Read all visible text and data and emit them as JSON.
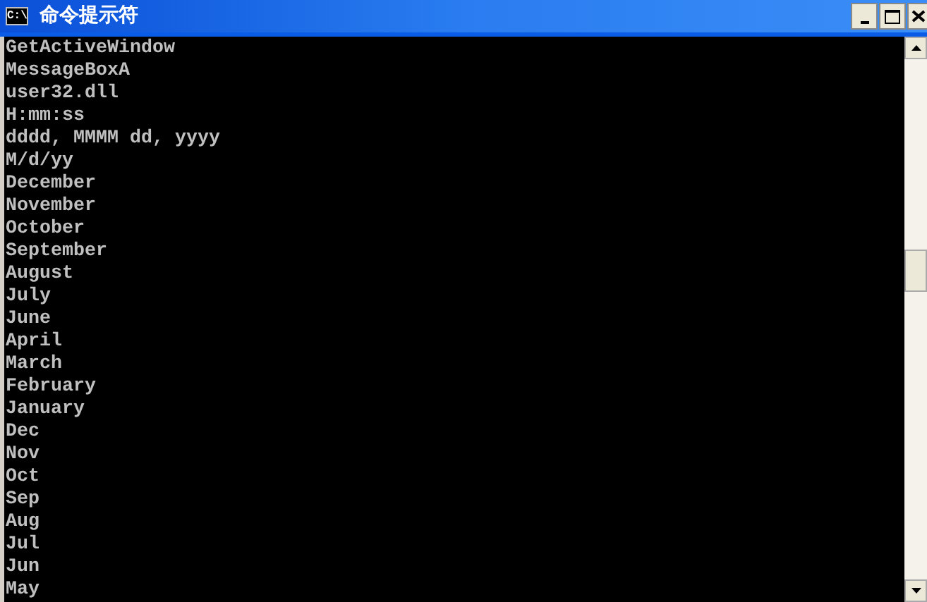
{
  "window": {
    "title": "命令提示符",
    "icon_text": "C:\\"
  },
  "console": {
    "lines": [
      "GetActiveWindow",
      "MessageBoxA",
      "user32.dll",
      "H:mm:ss",
      "dddd, MMMM dd, yyyy",
      "M/d/yy",
      "December",
      "November",
      "October",
      "September",
      "August",
      "July",
      "June",
      "April",
      "March",
      "February",
      "January",
      "Dec",
      "Nov",
      "Oct",
      "Sep",
      "Aug",
      "Jul",
      "Jun",
      "May"
    ]
  }
}
